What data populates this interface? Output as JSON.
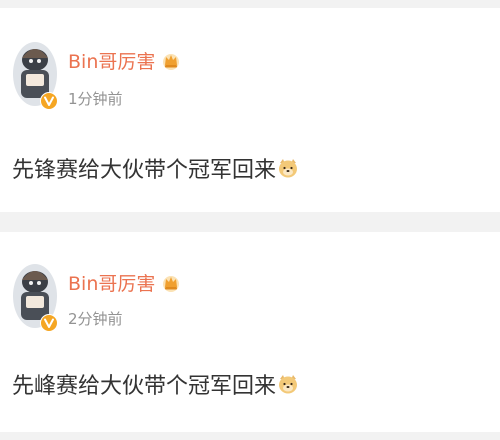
{
  "posts": [
    {
      "username": "Bin哥厉害",
      "timestamp": "1分钟前",
      "content": "先锋赛给大伙带个冠军回来"
    },
    {
      "username": "Bin哥厉害",
      "timestamp": "2分钟前",
      "content": "先峰赛给大伙带个冠军回来"
    }
  ],
  "icons": {
    "avatar": "profile-avatar",
    "verified": "verified-v-badge-icon",
    "crown": "crown-icon",
    "emoji": "doge-emoji-icon"
  },
  "colors": {
    "username": "#eb7350",
    "timestamp": "#939393",
    "content": "#333333",
    "verified_badge": "#f5a623",
    "background": "#f2f2f2"
  }
}
